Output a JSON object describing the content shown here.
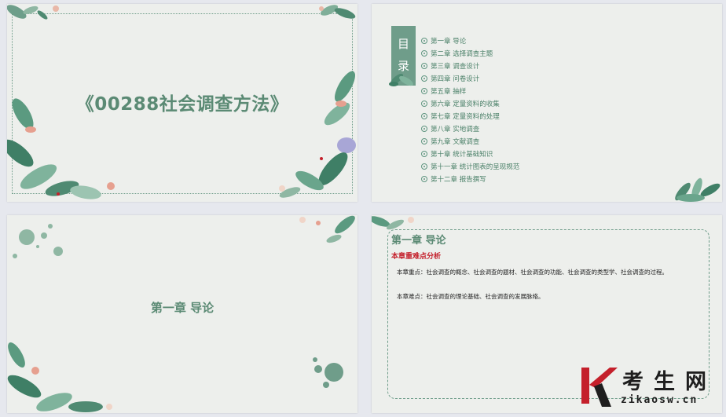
{
  "slide1": {
    "title": "《00288社会调查方法》"
  },
  "slide2": {
    "heading_chars": [
      "目",
      "录"
    ],
    "toc": [
      "第一章  导论",
      "第二章  选择调查主题",
      "第三章  调查设计",
      "第四章  问卷设计",
      "第五章  抽样",
      "第六章  定量资料的收集",
      "第七章  定量资料的处理",
      "第八章  实地调查",
      "第九章  文献调查",
      "第十章  统计基础知识",
      "第十一章  统计图表的呈现规范",
      "第十二章  报告撰写"
    ]
  },
  "slide3": {
    "chapter": "第一章  导论"
  },
  "slide4": {
    "chapter": "第一章  导论",
    "subtitle": "本章重难点分析",
    "key_points": "本章重点：社会调查的概念、社会调查的题材、社会调查的功能、社会调查的类型学、社会调查的过程。",
    "difficult_points": "本章难点：社会调查的理论基础、社会调查的发展脉络。"
  },
  "watermark": {
    "brand": "考生网",
    "url": "zikaosw.cn"
  },
  "colors": {
    "accent_green": "#6f9d8a",
    "text_green": "#5b8a74",
    "highlight_red": "#c4202b",
    "logo_red": "#c4202b"
  }
}
